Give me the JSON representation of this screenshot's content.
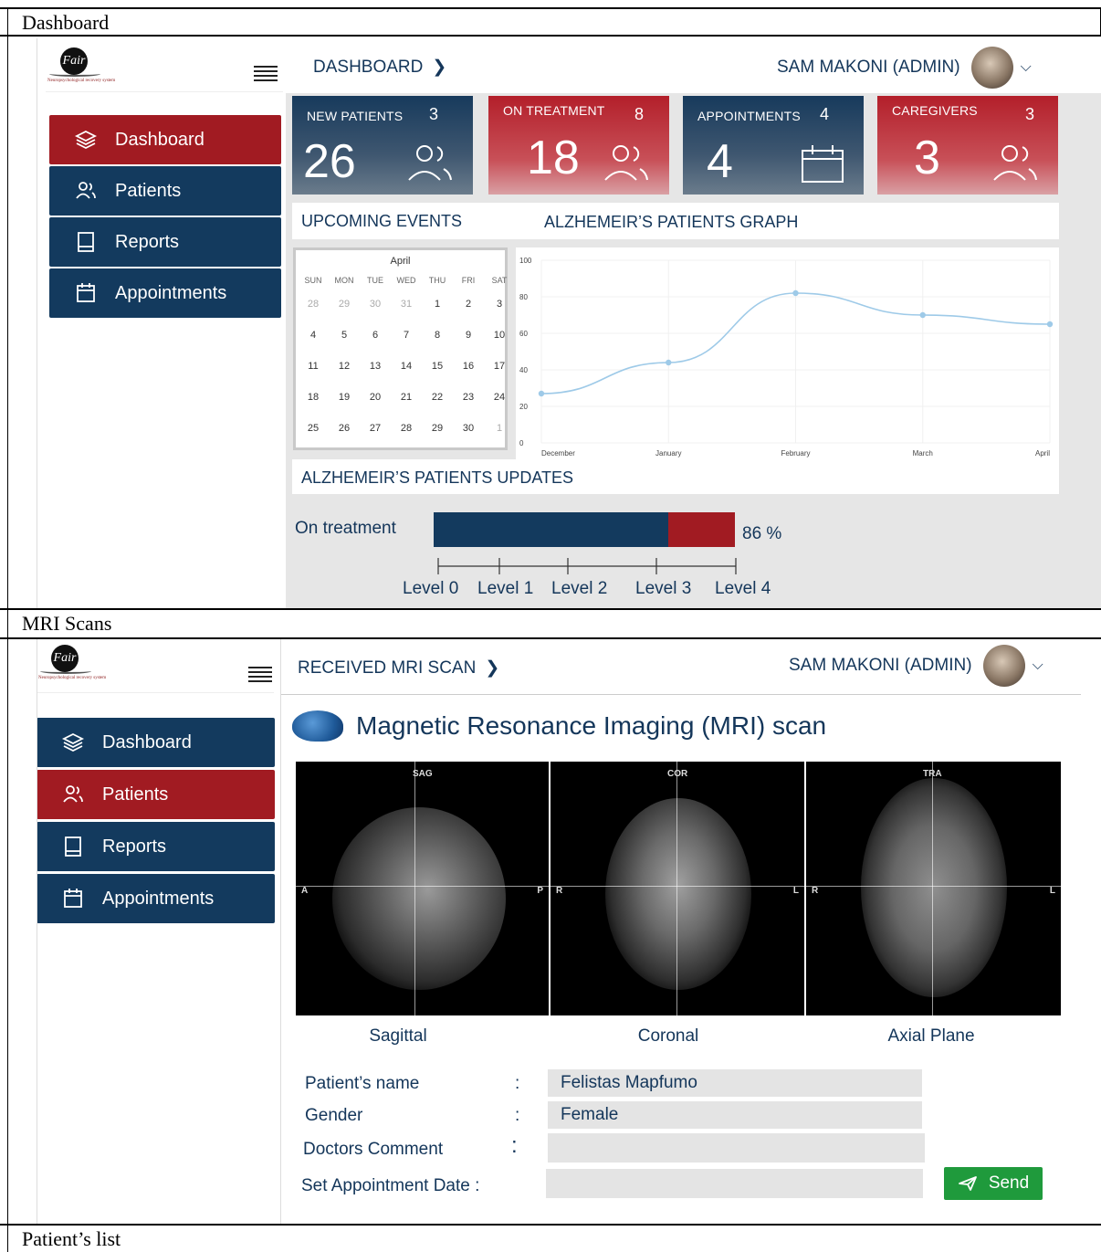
{
  "captions": {
    "dashboard": "Dashboard",
    "mri": "MRI Scans",
    "patients_list": "Patient’s list"
  },
  "app": {
    "logo_tagline": "Neuropsychological recovery system",
    "logo_mark": "Fair"
  },
  "sidebar": {
    "items": [
      {
        "label": "Dashboard",
        "icon": "layers-icon"
      },
      {
        "label": "Patients",
        "icon": "users-icon"
      },
      {
        "label": "Reports",
        "icon": "book-icon"
      },
      {
        "label": "Appointments",
        "icon": "calendar-icon"
      }
    ]
  },
  "dashboard": {
    "breadcrumb": "DASHBOARD",
    "user": "SAM MAKONI (ADMIN)",
    "cards": [
      {
        "label": "NEW PATIENTS",
        "count": "3",
        "value": "26",
        "icon": "users-icon",
        "color": "#173a5c"
      },
      {
        "label": "ON TREATMENT",
        "count": "8",
        "value": "18",
        "icon": "users-icon",
        "color": "#b31f2a"
      },
      {
        "label": "APPOINTMENTS",
        "count": "4",
        "value": "4",
        "icon": "calendar-icon",
        "color": "#173a5c"
      },
      {
        "label": "CAREGIVERS",
        "count": "3",
        "value": "3",
        "icon": "users-icon",
        "color": "#b31f2a"
      }
    ],
    "upcoming_events": "UPCOMING EVENTS",
    "graph_title": "ALZHEMEIR’S PATIENTS GRAPH",
    "updates_title": "ALZHEMEIR’S PATIENTS UPDATES",
    "calendar": {
      "month": "April",
      "weekdays": [
        "SUN",
        "MON",
        "TUE",
        "WED",
        "THU",
        "FRI",
        "SAT"
      ],
      "weeks": [
        [
          "28",
          "29",
          "30",
          "31",
          "1",
          "2",
          "3"
        ],
        [
          "4",
          "5",
          "6",
          "7",
          "8",
          "9",
          "10"
        ],
        [
          "11",
          "12",
          "13",
          "14",
          "15",
          "16",
          "17"
        ],
        [
          "18",
          "19",
          "20",
          "21",
          "22",
          "23",
          "24"
        ],
        [
          "25",
          "26",
          "27",
          "28",
          "29",
          "30",
          "1"
        ]
      ],
      "muted": [
        [
          0,
          0
        ],
        [
          0,
          1
        ],
        [
          0,
          2
        ],
        [
          0,
          3
        ],
        [
          4,
          6
        ]
      ]
    },
    "progress": {
      "label": "On treatment",
      "percent_text": "86 %",
      "blue_fraction": 0.78,
      "total_fraction": 1.0,
      "levels": [
        "Level 0",
        "Level 1",
        "Level 2",
        "Level 3",
        "Level 4"
      ]
    }
  },
  "chart_data": {
    "type": "line",
    "categories": [
      "December",
      "January",
      "February",
      "March",
      "April"
    ],
    "values": [
      27,
      44,
      82,
      70,
      65
    ],
    "ylim": [
      0,
      100
    ],
    "yticks": [
      "0",
      "20",
      "40",
      "60",
      "80",
      "100"
    ],
    "color": "#9ecae8"
  },
  "mri": {
    "breadcrumb": "RECEIVED MRI SCAN",
    "user": "SAM MAKONI (ADMIN)",
    "title": "Magnetic Resonance Imaging (MRI) scan",
    "scans": [
      {
        "tag": "SAG",
        "left": "A",
        "right": "P",
        "label": "Sagittal"
      },
      {
        "tag": "COR",
        "left": "R",
        "right": "L",
        "label": "Coronal"
      },
      {
        "tag": "TRA",
        "left": "R",
        "right": "L",
        "label": "Axial Plane"
      }
    ],
    "form": {
      "name_label": "Patient’s name",
      "name_value": "Felistas Mapfumo",
      "gender_label": "Gender",
      "gender_value": "Female",
      "comment_label": "Doctors Comment",
      "comment_value": "",
      "date_label": "Set Appointment Date :",
      "date_value": "",
      "colon": ":",
      "send_label": "Send"
    }
  }
}
